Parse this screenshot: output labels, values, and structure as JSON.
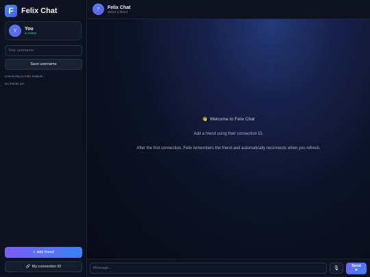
{
  "brand": {
    "logo_letter": "F",
    "name": "Felix Chat"
  },
  "profile": {
    "avatar_letter": "Y",
    "name": "You",
    "status": "● Online"
  },
  "username": {
    "placeholder": "Your username",
    "value": ""
  },
  "save_button": {
    "label": "Save username"
  },
  "connection_status": "Connecting to Felix network...",
  "friends": {
    "empty_text": "No friends yet.",
    "items": []
  },
  "add_friend_button": {
    "icon": "+",
    "label": "Add friend"
  },
  "connection_id_button": {
    "icon": "🔗",
    "label": "My connection ID"
  },
  "chat_header": {
    "avatar_letter": "?",
    "title": "Felix Chat",
    "subtitle": "Select a friend"
  },
  "welcome": {
    "emoji": "👋",
    "title": "Welcome to Felix Chat",
    "line1": "Add a friend using their connection ID.",
    "line2": "After the first connection, Felix remembers the friend and automatically reconnects when you refresh."
  },
  "composer": {
    "placeholder": "Message...",
    "mic_icon": "🎙",
    "send_label": "Send",
    "send_icon": "➤"
  },
  "colors": {
    "accent": "#3b82f6",
    "accent_purple": "#7b5cf5",
    "online": "#37d39a",
    "background": "#0b0f1a"
  }
}
